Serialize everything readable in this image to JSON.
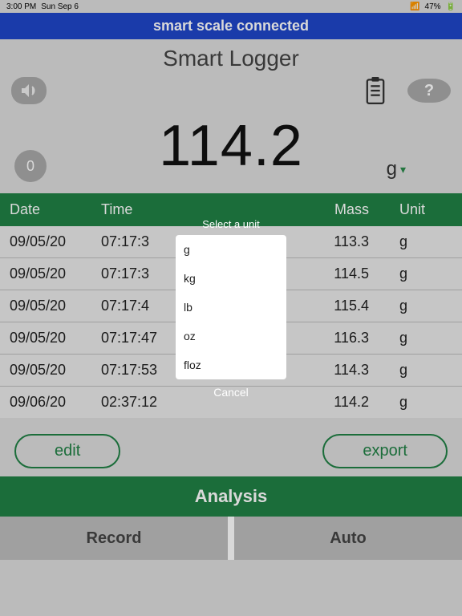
{
  "status": {
    "time": "3:00 PM",
    "date": "Sun Sep 6",
    "wifi": "􀙇",
    "battery_pct": "47%"
  },
  "banner": "smart scale connected",
  "title": "Smart Logger",
  "counter": "0",
  "reading": "114.2",
  "unit_selected": "g",
  "columns": {
    "date": "Date",
    "time": "Time",
    "mass": "Mass",
    "unit": "Unit"
  },
  "rows": [
    {
      "date": "09/05/20",
      "time": "07:17:3",
      "mass": "113.3",
      "unit": "g"
    },
    {
      "date": "09/05/20",
      "time": "07:17:3",
      "mass": "114.5",
      "unit": "g"
    },
    {
      "date": "09/05/20",
      "time": "07:17:4",
      "mass": "115.4",
      "unit": "g"
    },
    {
      "date": "09/05/20",
      "time": "07:17:47",
      "mass": "116.3",
      "unit": "g"
    },
    {
      "date": "09/05/20",
      "time": "07:17:53",
      "mass": "114.3",
      "unit": "g"
    },
    {
      "date": "09/06/20",
      "time": "02:37:12",
      "mass": "114.2",
      "unit": "g"
    }
  ],
  "buttons": {
    "edit": "edit",
    "export": "export"
  },
  "analysis": "Analysis",
  "tabs": {
    "record": "Record",
    "auto": "Auto"
  },
  "modal": {
    "title": "Select a unit",
    "options": [
      "g",
      "kg",
      "lb",
      "oz",
      "floz"
    ],
    "cancel": "Cancel"
  },
  "help_glyph": "?"
}
